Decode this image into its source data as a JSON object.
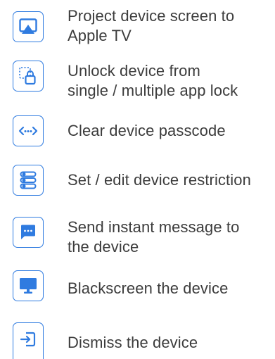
{
  "actions": [
    {
      "lines": [
        "Project device screen to",
        "Apple TV"
      ],
      "icon": "airplay-icon"
    },
    {
      "lines": [
        "Unlock device from",
        "single / multiple app lock"
      ],
      "icon": "app-unlock-icon"
    },
    {
      "lines": [
        "Clear device passcode"
      ],
      "icon": "code-dots-icon"
    },
    {
      "lines": [
        "Set / edit device restriction"
      ],
      "icon": "toggles-icon"
    },
    {
      "lines": [
        "Send instant message to",
        "the device"
      ],
      "icon": "message-icon"
    },
    {
      "lines": [
        "Blackscreen the device"
      ],
      "icon": "monitor-icon"
    },
    {
      "lines": [
        "Dismiss the device"
      ],
      "icon": "exit-icon"
    }
  ],
  "colors": {
    "accent": "#2f7be0",
    "text": "#3c3c3c"
  }
}
